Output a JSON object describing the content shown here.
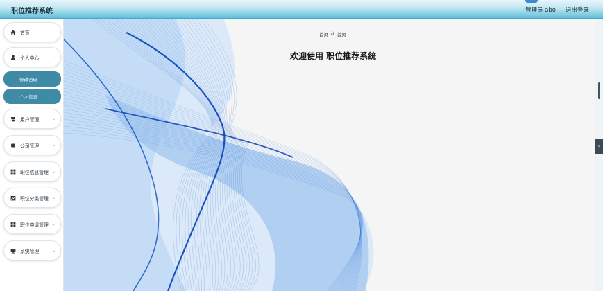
{
  "app": {
    "title": "职位推荐系统"
  },
  "header": {
    "user_label": "管理员 abo",
    "logout_label": "退出登录"
  },
  "sidebar": {
    "items": [
      {
        "label": "首页",
        "icon": "home-icon"
      },
      {
        "label": "个人中心",
        "icon": "user-icon",
        "expanded": true
      },
      {
        "label": "用户管理",
        "icon": "user-manage-icon"
      },
      {
        "label": "公司管理",
        "icon": "company-icon"
      },
      {
        "label": "职位信息管理",
        "icon": "grid-icon"
      },
      {
        "label": "职位分类管理",
        "icon": "chart-icon"
      },
      {
        "label": "职位申请管理",
        "icon": "grid-icon"
      },
      {
        "label": "系统管理",
        "icon": "monitor-icon"
      }
    ],
    "sub_items": [
      {
        "label": "修改密码"
      },
      {
        "label": "个人信息"
      }
    ]
  },
  "breadcrumb": {
    "first": "首页",
    "separator": "//",
    "second": "首页"
  },
  "main": {
    "welcome_text": "欢迎使用 职位推荐系统"
  },
  "colors": {
    "accent": "#3f8ba6",
    "topbar": "#5fbfd9",
    "wave": "#1f5fc9"
  }
}
